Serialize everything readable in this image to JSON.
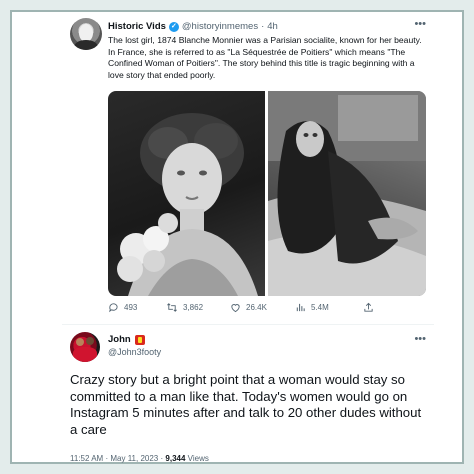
{
  "quoted_tweet": {
    "author_name": "Historic Vids",
    "author_handle": "@historyinmemes",
    "separator": "·",
    "timestamp": "4h",
    "more_icon": "more-horizontal-icon",
    "text": "The lost girl, 1874 Blanche Monnier was a Parisian socialite, known for her beauty. In France, she is referred to as \"La Séquestrée de Poitiers\" which means \"The Confined Woman of Poitiers\". The story behind this title is tragic beginning with a love story that ended poorly.",
    "media": [
      {
        "description_icon": "portrait-photo",
        "tone": "dark"
      },
      {
        "description_icon": "confined-woman-photo",
        "tone": "grey"
      }
    ],
    "actions": {
      "replies": "493",
      "retweets": "3,862",
      "likes": "26.4K",
      "views": "5.4M"
    }
  },
  "reply_tweet": {
    "author_name": "John",
    "author_handle": "@John3footy",
    "text": "Crazy story but a bright point that a woman would stay so committed to a man like that. Today's women would go on Instagram 5 minutes after and talk to 20 other dudes without a care",
    "time": "11:52 AM",
    "separator": "·",
    "date": "May 11, 2023",
    "views_count": "9,344",
    "views_label": "Views"
  },
  "colors": {
    "background": "#e3eceb",
    "border": "#9fb4b2",
    "accent": "#1d9bf0",
    "secondary_text": "#536471"
  }
}
